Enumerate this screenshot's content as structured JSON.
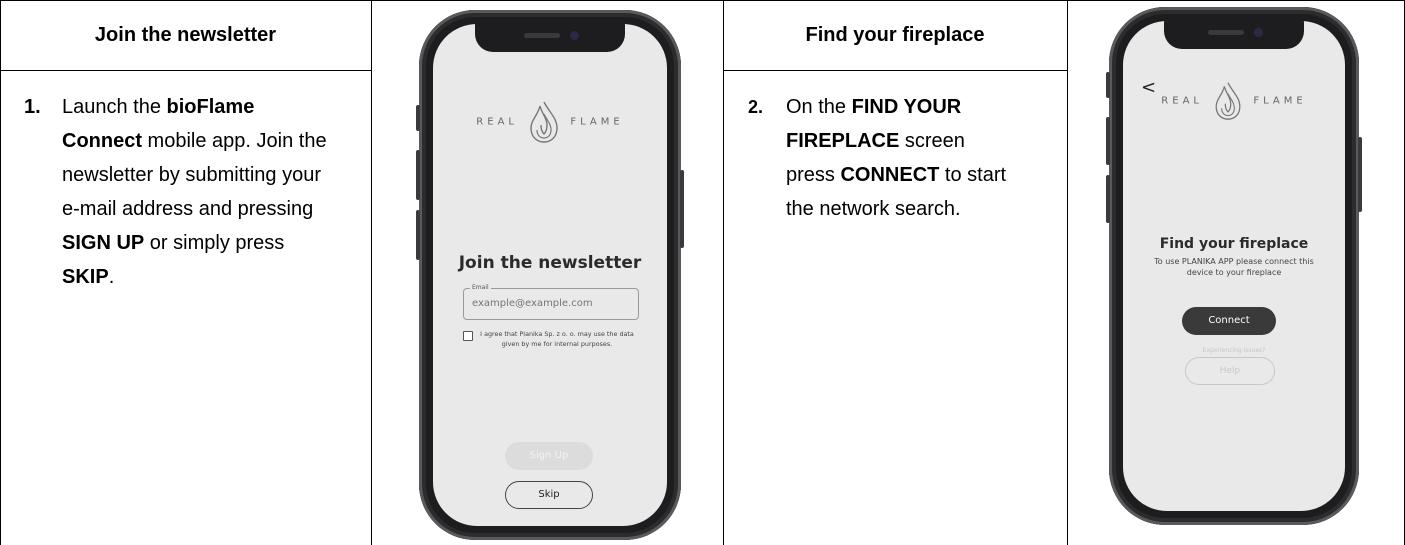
{
  "columns": {
    "left_header": "Join the newsletter",
    "right_header": "Find your fireplace"
  },
  "step1": {
    "number": "1.",
    "t1": "Launch the ",
    "b1": "bioFlame Connect",
    "t2": " mobile app. Join the newsletter by submitting your e-mail address and pressing ",
    "b2": "SIGN UP",
    "t3": " or simply press ",
    "b3": "SKIP",
    "t4": "."
  },
  "step2": {
    "number": "2.",
    "t1": "On the ",
    "b1": "FIND YOUR FIREPLACE",
    "t2": " screen press ",
    "b2": "CONNECT",
    "t3": " to start the network search."
  },
  "phone1": {
    "logo_left": "REAL",
    "logo_right": "FLAME",
    "title": "Join the newsletter",
    "email_label": "Email",
    "email_placeholder": "example@example.com",
    "consent": "I agree that Planika Sp. z o. o. may use the data given by me for internal purposes.",
    "signup_label": "Sign Up",
    "skip_label": "Skip"
  },
  "phone2": {
    "back_glyph": "<",
    "logo_left": "REAL",
    "logo_right": "FLAME",
    "title": "Find your fireplace",
    "subtitle": "To use PLANIKA APP please connect this device to your fireplace",
    "connect_label": "Connect",
    "issues_text": "Experiencing issues?",
    "help_label": "Help"
  },
  "colors": {
    "screen_bg": "#e9e9e9",
    "connect_bg": "#3a3a3a",
    "signup_bg": "#dcdcdc",
    "frame": "#1d1d1f"
  }
}
